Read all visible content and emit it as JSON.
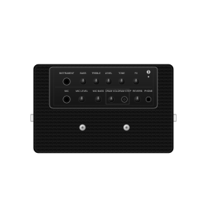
{
  "product": {
    "subject": "compact guitar amplifier"
  },
  "control_panel": {
    "top_row": [
      {
        "label": "INSTRUMENT"
      },
      {
        "label": "BASS"
      },
      {
        "label": "TREBLE"
      },
      {
        "label": "LEVEL"
      },
      {
        "label": "TONE"
      },
      {
        "label": "FX"
      }
    ],
    "bottom_row": [
      {
        "label": "MIC"
      },
      {
        "label": "MIC LEVEL"
      },
      {
        "label": "MIC BASS"
      },
      {
        "label": "DRUM VOL"
      },
      {
        "label": "DRUM STEP"
      },
      {
        "label": "REVERB"
      },
      {
        "label": "PHONE"
      }
    ]
  },
  "colors": {
    "background": "#ffffff",
    "cabinet": "#111111",
    "panel": "#1b1b1b",
    "trim": "#9b9b9b"
  }
}
